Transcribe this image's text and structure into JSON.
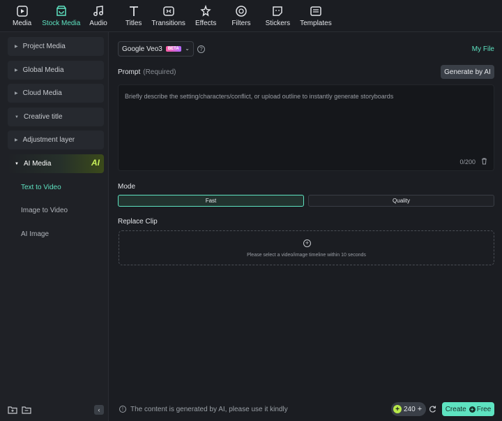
{
  "toolbar": {
    "tabs": [
      {
        "label": "Media",
        "icon": "media-icon"
      },
      {
        "label": "Stock Media",
        "icon": "stock-media-icon"
      },
      {
        "label": "Audio",
        "icon": "music-note-icon"
      },
      {
        "label": "Titles",
        "icon": "titles-icon"
      },
      {
        "label": "Transitions",
        "icon": "transitions-icon"
      },
      {
        "label": "Effects",
        "icon": "effects-icon"
      },
      {
        "label": "Filters",
        "icon": "filters-icon"
      },
      {
        "label": "Stickers",
        "icon": "stickers-icon"
      },
      {
        "label": "Templates",
        "icon": "templates-icon"
      }
    ],
    "active_tab": "Stock Media"
  },
  "sidebar": {
    "items": [
      {
        "label": "Project Media"
      },
      {
        "label": "Global Media"
      },
      {
        "label": "Cloud Media"
      },
      {
        "label": "Creative title"
      },
      {
        "label": "Adjustment layer"
      },
      {
        "label": "AI Media"
      }
    ],
    "ai_badge": "AI",
    "sub_items": [
      {
        "label": "Text to Video"
      },
      {
        "label": "Image to Video"
      },
      {
        "label": "AI Image"
      }
    ],
    "active_sub_item": "Text to Video"
  },
  "main": {
    "model_name": "Google Veo3",
    "model_badge": "BETA",
    "help_symbol": "?",
    "my_file": "My File",
    "prompt_label": "Prompt",
    "prompt_required": "(Required)",
    "generate_button": "Generate by AI",
    "prompt_placeholder": "Briefly describe the setting/characters/conflict, or upload outline to instantly generate storyboards",
    "prompt_counter": "0/200",
    "mode_label": "Mode",
    "mode_options": [
      "Fast",
      "Quality"
    ],
    "mode_selected": "Fast",
    "replace_clip_label": "Replace Clip",
    "drop_plus": "+",
    "drop_hint": "Please select a video/image timeline within 10 seconds"
  },
  "footer": {
    "info_symbol": "!",
    "notice": "The content is generated by AI, please use it kindly",
    "credits": "240",
    "credit_plus": "+",
    "create_label": "Create",
    "create_suffix": "Free"
  },
  "colors": {
    "accent": "#5ee3c1",
    "background": "#1b1d22",
    "credit": "#b8e94a"
  }
}
